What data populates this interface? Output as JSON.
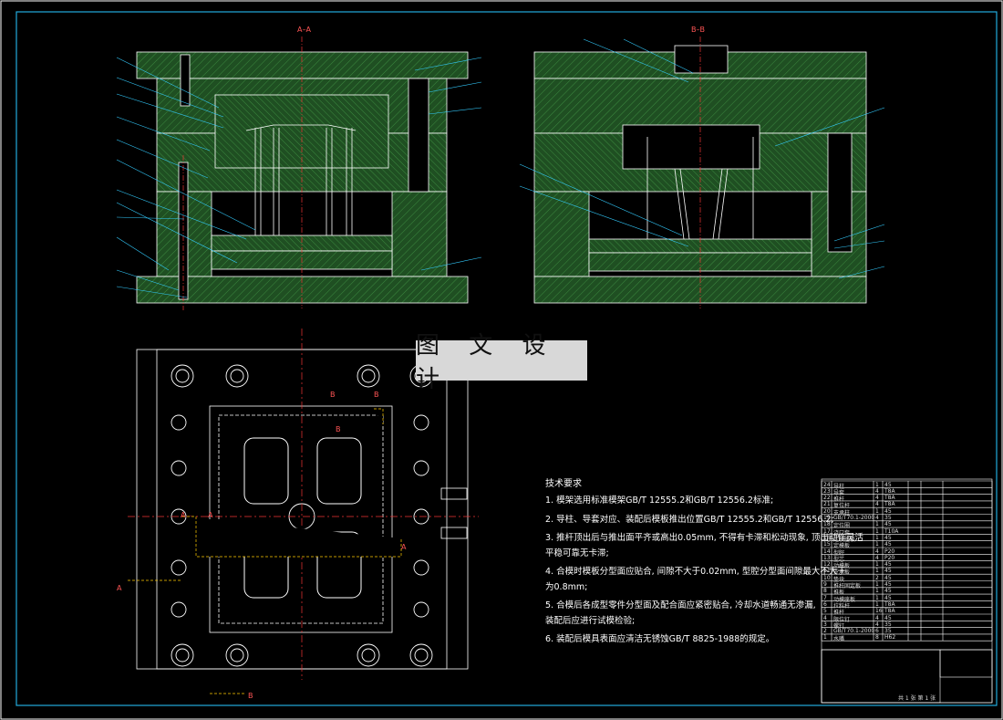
{
  "watermark": "图 文 设 计",
  "section_labels": {
    "aa": "A–A",
    "bb": "B–B"
  },
  "cut_marks": [
    "A",
    "A",
    "A",
    "A",
    "B",
    "B",
    "B",
    "B"
  ],
  "tech_notes": {
    "title": "技术要求",
    "items": [
      "1. 模架选用标准模架GB/T 12555.2和GB/T 12556.2标准;",
      "2. 导柱、导套对应、装配后模板推出位置GB/T 12555.2和GB/T 12556.2;",
      "3. 推杆顶出后与推出面平齐或高出0.05mm, 不得有卡滞和松动现象, 顶出动作灵活",
      "   平稳可靠无卡滞;",
      "4. 合模时模板分型面应贴合, 间隙不大于0.02mm, 型腔分型面间隙最大不大于",
      "   为0.8mm;",
      "5. 合模后各成型零件分型面及配合面应紧密贴合, 冷却水道畅通无渗漏,",
      "   装配后应进行试模检验;",
      "6. 装配后模具表面应清洁无锈蚀GB/T 8825-1988的规定。"
    ]
  },
  "title_block": {
    "rows": [
      [
        "24",
        "导柱",
        "1",
        "45",
        "",
        "",
        ""
      ],
      [
        "23",
        "导套",
        "4",
        "T8A",
        "",
        "",
        ""
      ],
      [
        "22",
        "推杆",
        "4",
        "T8A",
        "",
        "",
        ""
      ],
      [
        "21",
        "复位杆",
        "4",
        "T8A",
        "",
        "",
        ""
      ],
      [
        "20",
        "支承柱",
        "1",
        "45",
        "",
        "",
        ""
      ],
      [
        "19",
        "GB/T70.1-2000",
        "4",
        "35",
        "",
        "",
        ""
      ],
      [
        "18",
        "定位圈",
        "1",
        "45",
        "",
        "",
        ""
      ],
      [
        "17",
        "浇口套",
        "1",
        "T10A",
        "",
        "",
        ""
      ],
      [
        "16",
        "定模座板",
        "1",
        "45",
        "",
        "",
        ""
      ],
      [
        "15",
        "定模板",
        "1",
        "45",
        "",
        "",
        ""
      ],
      [
        "14",
        "型腔",
        "4",
        "P20",
        "",
        "",
        ""
      ],
      [
        "13",
        "型芯",
        "4",
        "P20",
        "",
        "",
        ""
      ],
      [
        "12",
        "动模板",
        "1",
        "45",
        "",
        "",
        ""
      ],
      [
        "11",
        "支承板",
        "1",
        "45",
        "",
        "",
        ""
      ],
      [
        "10",
        "垫块",
        "2",
        "45",
        "",
        "",
        ""
      ],
      [
        "9",
        "推杆固定板",
        "1",
        "45",
        "",
        "",
        ""
      ],
      [
        "8",
        "推板",
        "1",
        "45",
        "",
        "",
        ""
      ],
      [
        "7",
        "动模座板",
        "1",
        "45",
        "",
        "",
        ""
      ],
      [
        "6",
        "拉料杆",
        "1",
        "T8A",
        "",
        "",
        ""
      ],
      [
        "5",
        "推杆",
        "16",
        "T8A",
        "",
        "",
        ""
      ],
      [
        "4",
        "限位钉",
        "4",
        "45",
        "",
        "",
        ""
      ],
      [
        "3",
        "螺钉",
        "4",
        "35",
        "",
        "",
        ""
      ],
      [
        "2",
        "GB/T70.1-2000",
        "6",
        "35",
        "",
        "",
        ""
      ],
      [
        "1",
        "水嘴",
        "8",
        "H62",
        "",
        "",
        ""
      ]
    ],
    "footer": "共 1 张  第 1 张"
  }
}
